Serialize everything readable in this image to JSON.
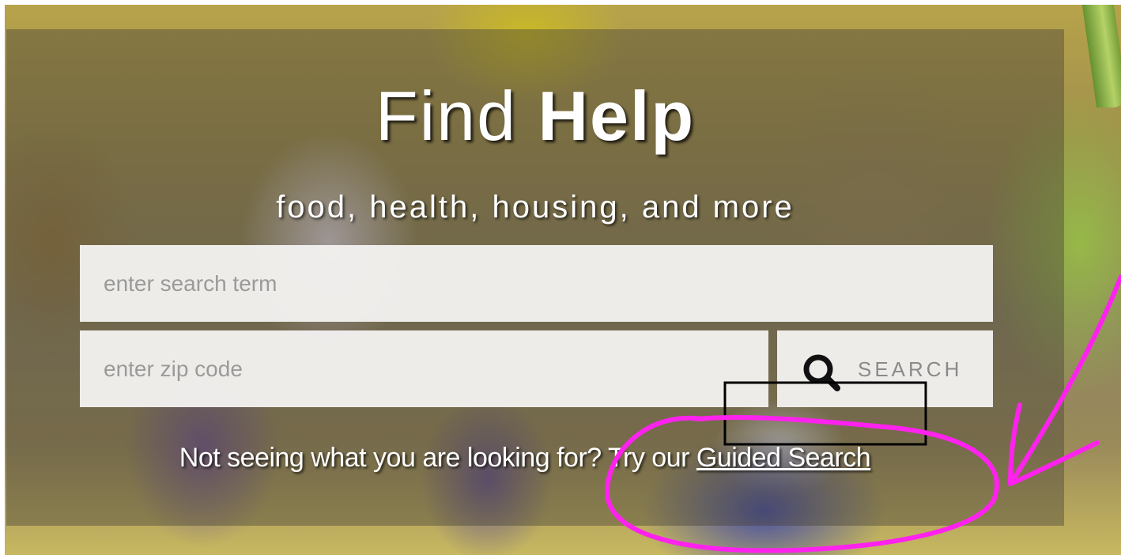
{
  "hero": {
    "title_regular": "Find",
    "title_bold": "Help",
    "subtitle": "food, health, housing, and more"
  },
  "search": {
    "term_placeholder": "enter search term",
    "zip_placeholder": "enter zip code",
    "button_label": "SEARCH",
    "button_icon": "magnifying-glass"
  },
  "guided": {
    "prompt": "Not seeing what you are looking for? Try our ",
    "link_label": "Guided Search"
  },
  "colors": {
    "overlay": "#46413780",
    "field_background": "#f2f1ee",
    "annotation_highlight": "#ff22ee",
    "annotation_box": "#000000"
  }
}
